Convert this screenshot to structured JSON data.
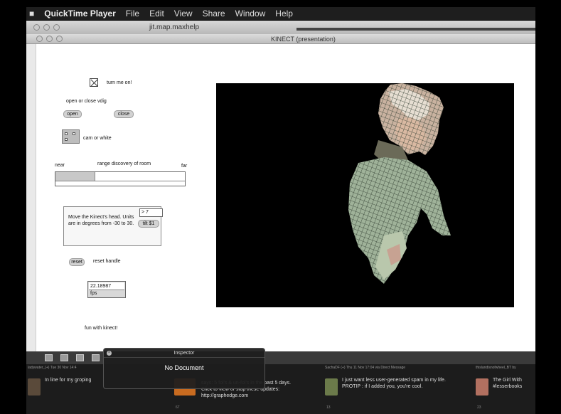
{
  "menubar": {
    "app": "QuickTime Player",
    "items": [
      "File",
      "Edit",
      "View",
      "Share",
      "Window",
      "Help"
    ]
  },
  "back_window": {
    "title": "jit.map.maxhelp"
  },
  "main_window": {
    "title": "KINECT (presentation)"
  },
  "patch": {
    "toggle_label": "turn me on!",
    "open_close_label": "open or close vdig",
    "open_button": "open",
    "close_button": "close",
    "cam_label": "cam or white",
    "near_label": "near",
    "range_label": "range discovery of room",
    "far_label": "far",
    "range_slider_level": 0.31,
    "head_comment": "Move the Kinect's head. Units are in degrees from -30 to 30.",
    "tilt_number": "> 7",
    "tilt_message": "tilt $1",
    "reset_button": "reset",
    "reset_label": "reset handle",
    "float_value": "22.18987",
    "fps_label": "fps",
    "footer_label": "fun with kinect!"
  },
  "inspector": {
    "title": "Inspector",
    "body": "No Document"
  },
  "feed": [
    {
      "meta": "ladywater_(+) Tue 30 Nov 14:4",
      "text": "In line for my groping"
    },
    {
      "meta": "",
      "text": "says: 5 fol's & un-fol's in the past 5 days. Click to view or stop these updates: http://graphedge.com",
      "count": "67"
    },
    {
      "meta": "SachaDF (+) Thu 11 Nov 17:04 via Direct Message",
      "text": "I just want less user-generated spam in my life. PROTIP : if I added you, you're cool.",
      "count": "13"
    },
    {
      "meta": "thislandisnofwheel_BT by",
      "text": "The Girl With #lesserbooks",
      "count": "23"
    }
  ],
  "colors": {
    "window_bg": "#ffffff",
    "desktop": "#000000",
    "viewport": "#000000"
  }
}
